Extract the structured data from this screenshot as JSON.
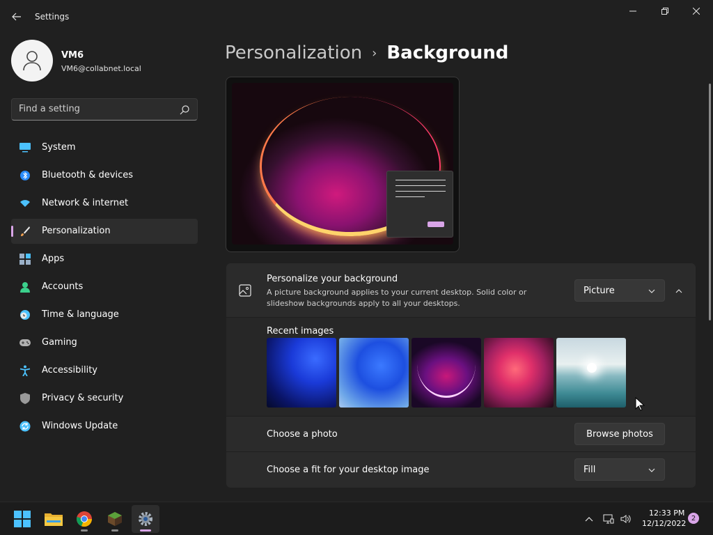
{
  "window": {
    "title": "Settings",
    "icons": {
      "back": "back-arrow-icon",
      "minimize": "minimize-icon",
      "maximize": "maximize-icon",
      "close": "close-icon"
    }
  },
  "user": {
    "name": "VM6",
    "email": "VM6@collabnet.local"
  },
  "search": {
    "placeholder": "Find a setting"
  },
  "sidebar": {
    "items": [
      {
        "label": "System",
        "icon": "system-icon",
        "color": "#4cc2ff"
      },
      {
        "label": "Bluetooth & devices",
        "icon": "bluetooth-icon",
        "color": "#2a8cff"
      },
      {
        "label": "Network & internet",
        "icon": "wifi-icon",
        "color": "#4cc2ff"
      },
      {
        "label": "Personalization",
        "icon": "paintbrush-icon",
        "color": "#f0a050",
        "active": true
      },
      {
        "label": "Apps",
        "icon": "apps-icon",
        "color": "#9ab0c8"
      },
      {
        "label": "Accounts",
        "icon": "accounts-icon",
        "color": "#3bd08c"
      },
      {
        "label": "Time & language",
        "icon": "clock-globe-icon",
        "color": "#4cc2ff"
      },
      {
        "label": "Gaming",
        "icon": "gamepad-icon",
        "color": "#b0b0b0"
      },
      {
        "label": "Accessibility",
        "icon": "accessibility-icon",
        "color": "#4cc2ff"
      },
      {
        "label": "Privacy & security",
        "icon": "shield-icon",
        "color": "#9a9a9a"
      },
      {
        "label": "Windows Update",
        "icon": "update-icon",
        "color": "#4cc2ff"
      }
    ]
  },
  "breadcrumb": {
    "parent": "Personalization",
    "separator": "›",
    "current": "Background"
  },
  "background": {
    "title": "Personalize your background",
    "description": "A picture background applies to your current desktop. Solid color or slideshow backgrounds apply to all your desktops.",
    "type_value": "Picture",
    "recent_label": "Recent images",
    "recent_images": [
      "bloom-blue-dark",
      "bloom-blue-light",
      "glow-purple",
      "bloom-colorful",
      "lake-sunrise"
    ],
    "choose_photo_label": "Choose a photo",
    "browse_button": "Browse photos",
    "fit_label": "Choose a fit for your desktop image",
    "fit_value": "Fill"
  },
  "accent_color": "#d9a5e8",
  "taskbar": {
    "apps": [
      {
        "name": "start-button",
        "icon": "windows-logo-icon"
      },
      {
        "name": "file-explorer",
        "icon": "folder-icon"
      },
      {
        "name": "chrome",
        "icon": "chrome-icon"
      },
      {
        "name": "minecraft",
        "icon": "minecraft-icon"
      },
      {
        "name": "settings",
        "icon": "gear-icon",
        "active": true
      }
    ],
    "time": "12:33 PM",
    "date": "12/12/2022",
    "notifications": "2"
  }
}
